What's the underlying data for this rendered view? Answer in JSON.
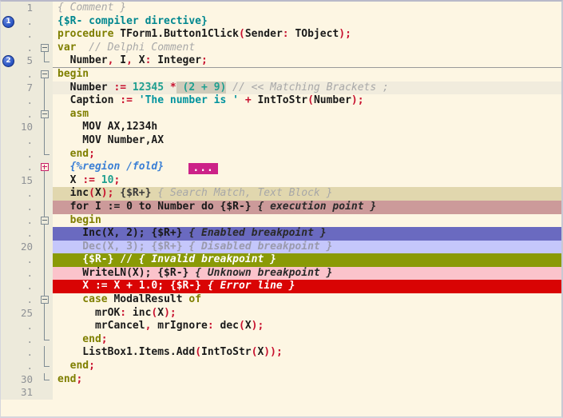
{
  "editor": {
    "title": "Delphi code editor sample",
    "font_size": "13px",
    "colors": {
      "background": "#fdf6e3",
      "gutter": "#edeadb",
      "keyword": "#7f7f00",
      "number": "#1f9f8f",
      "string": "#00939e",
      "symbol": "#c8102e",
      "comment": "#a8a8a8",
      "directive": "#00878f",
      "region": "#3a7fd5",
      "execution_point": "#cc9a9a",
      "search_match": "#e1d7ae",
      "enabled_breakpoint": "#6a6ac0",
      "disabled_breakpoint": "#c5c7fb",
      "invalid_breakpoint": "#8a9a06",
      "unknown_breakpoint": "#fbc3cb",
      "error_line": "#d90404",
      "fold_ellipsis": "#cc2288",
      "bookmark": "#2b56c4"
    }
  },
  "gutter": {
    "line_numbers": [
      "1",
      ".",
      ".",
      ".",
      "5",
      ".",
      "7",
      ".",
      ".",
      "10",
      ".",
      ".",
      ".",
      "15",
      ".",
      ".",
      ".",
      ".",
      "20",
      ".",
      ".",
      ".",
      ".",
      "25",
      ".",
      ".",
      ".",
      ".",
      "30",
      "31"
    ],
    "bookmarks": [
      {
        "line_index": 1,
        "label": "1"
      },
      {
        "line_index": 4,
        "label": "2"
      }
    ],
    "fold_markers": [
      {
        "line_index": 3,
        "type": "minus"
      },
      {
        "line_index": 5,
        "type": "minus"
      },
      {
        "line_index": 8,
        "type": "minus"
      },
      {
        "line_index": 12,
        "type": "plus"
      },
      {
        "line_index": 17,
        "type": "minus"
      },
      {
        "line_index": 22,
        "type": "minus"
      }
    ]
  },
  "fold_ellipsis_label": "...",
  "lines": [
    {
      "n": "1",
      "text": "{ Comment }"
    },
    {
      "n": ".",
      "text": "{$R- compiler directive}"
    },
    {
      "n": ".",
      "text": "procedure TForm1.Button1Click(Sender: TObject);"
    },
    {
      "n": ".",
      "text": "var  // Delphi Comment"
    },
    {
      "n": "5",
      "text": "  Number, I, X: Integer;"
    },
    {
      "n": ".",
      "text": "begin"
    },
    {
      "n": "7",
      "text": "  Number := 12345 * (2 + 9) // << Matching Brackets ;"
    },
    {
      "n": ".",
      "text": "  Caption := 'The number is ' + IntToStr(Number);"
    },
    {
      "n": ".",
      "text": "  asm"
    },
    {
      "n": "10",
      "text": "    MOV AX,1234h"
    },
    {
      "n": ".",
      "text": "    MOV Number,AX"
    },
    {
      "n": ".",
      "text": "  end;"
    },
    {
      "n": ".",
      "text": "  {%region /fold}    ..."
    },
    {
      "n": "15",
      "text": "  X := 10;"
    },
    {
      "n": ".",
      "text": "  inc(X); {$R+} { Search Match, Text Block }"
    },
    {
      "n": ".",
      "text": "  for I := 0 to Number do {$R-} { execution point }"
    },
    {
      "n": ".",
      "text": "  begin"
    },
    {
      "n": ".",
      "text": "    Inc(X, 2); {$R+} { Enabled breakpoint }"
    },
    {
      "n": "20",
      "text": "    Dec(X, 3); {$R+} { Disabled breakpoint }"
    },
    {
      "n": ".",
      "text": "    {$R-} // { Invalid breakpoint }"
    },
    {
      "n": ".",
      "text": "    WriteLN(X); {$R-} { Unknown breakpoint }"
    },
    {
      "n": ".",
      "text": "    X := X + 1.0; {$R-} { Error line }"
    },
    {
      "n": ".",
      "text": "    case ModalResult of"
    },
    {
      "n": "25",
      "text": "      mrOK: inc(X);"
    },
    {
      "n": ".",
      "text": "      mrCancel, mrIgnore: dec(X);"
    },
    {
      "n": ".",
      "text": "    end;"
    },
    {
      "n": ".",
      "text": "    ListBox1.Items.Add(IntToStr(X));"
    },
    {
      "n": ".",
      "text": "  end;"
    },
    {
      "n": "30",
      "text": "end;"
    },
    {
      "n": "31",
      "text": ""
    }
  ]
}
